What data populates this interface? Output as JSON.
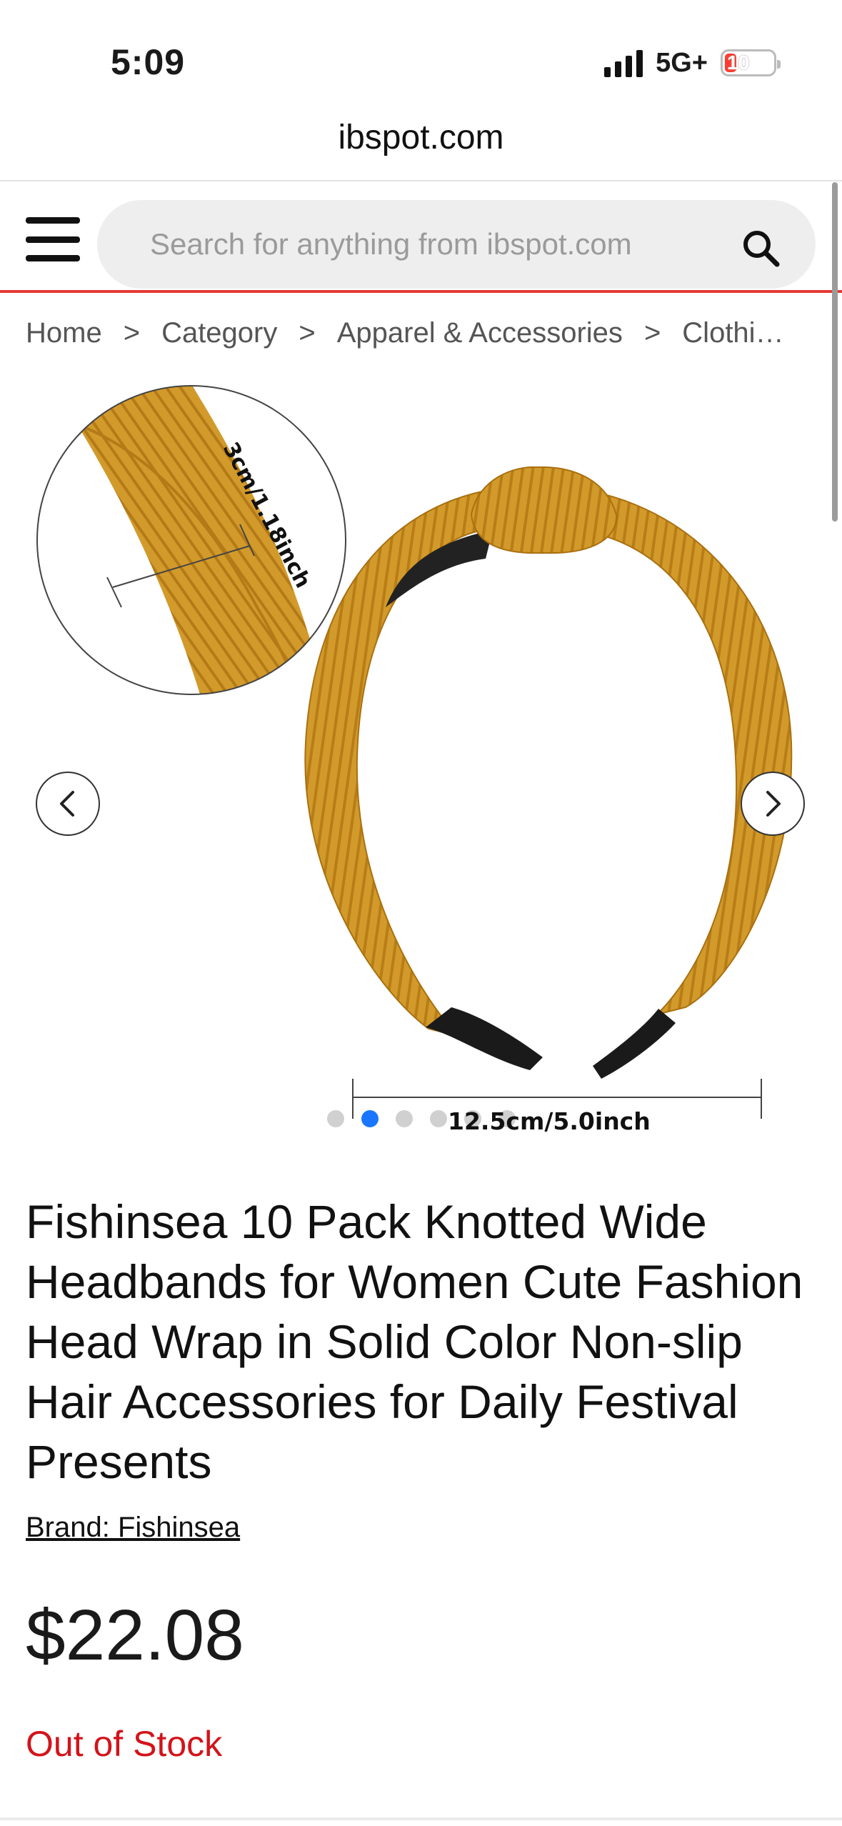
{
  "status_bar": {
    "time": "5:09",
    "network": "5G+",
    "battery": "10"
  },
  "browser": {
    "url": "ibspot.com"
  },
  "header": {
    "search_placeholder": "Search for anything from ibspot.com",
    "accent_color": "#e53935"
  },
  "breadcrumb": {
    "items": [
      "Home",
      "Category",
      "Apparel & Accessories",
      "Clothi…"
    ],
    "separator": ">"
  },
  "gallery": {
    "zoom_label": "3cm/1.18inch",
    "dimension_label": "12.5cm/5.0inch",
    "slide_count": 6,
    "active_slide": 2,
    "active_dot_color": "#1976ff"
  },
  "product": {
    "title": "Fishinsea 10 Pack Knotted Wide Headbands for Women Cute Fashion Head Wrap in Solid Color Non-slip Hair Accessories for Daily Festival Presents",
    "brand_link": "Brand: Fishinsea",
    "price": "$22.08",
    "stock_status": "Out of Stock",
    "stock_color": "#d3131a"
  }
}
